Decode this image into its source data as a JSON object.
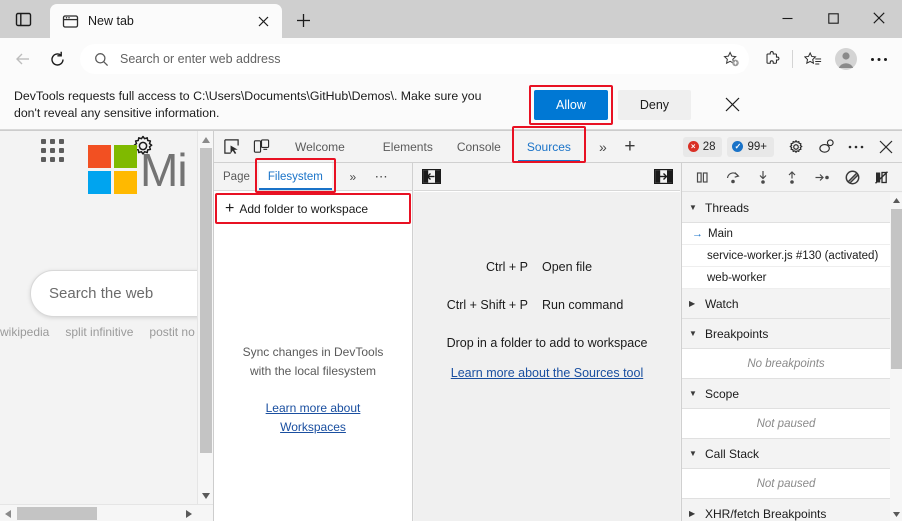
{
  "colors": {
    "accent_blue": "#0078d4",
    "highlight_red": "#e81123",
    "devtools_selected": "#1a73c8",
    "link_blue": "#1a4fa0",
    "ms_logo_red": "#f25022",
    "ms_logo_green": "#7fba00",
    "ms_logo_blue": "#00a4ef",
    "ms_logo_yellow": "#ffb900"
  },
  "browser": {
    "tab": {
      "title": "New tab",
      "favicon_name": "new-tab-favicon",
      "close_label": "×"
    },
    "tab_search_label": "tab-search",
    "new_tab_label": "+",
    "window_controls": {
      "minimize": "—",
      "maximize": "□",
      "close": "✕"
    },
    "toolbar": {
      "back_label": "←",
      "refresh_label": "refresh",
      "address_placeholder": "Search or enter web address",
      "address_value": "",
      "favorite_label": "add-favorite",
      "extensions_label": "extensions",
      "collections_label": "collections",
      "profile_label": "profile",
      "settings_label": "⋯"
    }
  },
  "notification": {
    "message_line1": "DevTools requests full access to C:\\Users\\Documents\\GitHub\\Demos\\. Make sure you",
    "message_line2": "don't reveal any sensitive information.",
    "allow_label": "Allow",
    "deny_label": "Deny",
    "close_label": "✕"
  },
  "page": {
    "waffle_label": "app-launcher",
    "gear_label": "page-settings",
    "brand_text": "Mi",
    "search_placeholder": "Search the web",
    "trending": [
      "wikipedia",
      "split infinitive",
      "postit no"
    ]
  },
  "devtools": {
    "inspect_label": "inspect-element",
    "device_label": "device-emulation",
    "tabs": [
      {
        "label": "Welcome",
        "selected": false
      },
      {
        "label": "Elements",
        "selected": false
      },
      {
        "label": "Console",
        "selected": false
      },
      {
        "label": "Sources",
        "selected": true
      }
    ],
    "more_tabs_label": "»",
    "add_tab_label": "+",
    "errors_count": "28",
    "errors_icon": "error-circle-icon",
    "messages_count": "99+",
    "messages_icon": "info-circle-icon",
    "settings_label": "devtools-settings",
    "customize_label": "devtools-customize",
    "more_label": "⋯",
    "close_label": "✕",
    "navigator": {
      "tabs": [
        {
          "label": "Page",
          "selected": false
        },
        {
          "label": "Filesystem",
          "selected": true
        }
      ],
      "more_label": "»",
      "dots_label": "⋯",
      "add_folder_label": "Add folder to workspace",
      "add_folder_plus": "+",
      "empty_line1": "Sync changes in DevTools",
      "empty_line2": "with the local filesystem",
      "link_line1": "Learn more about",
      "link_line2": "Workspaces"
    },
    "editor": {
      "show_navigator_label": "show-navigator",
      "show_debugger_label": "show-debugger",
      "shortcuts": [
        {
          "key": "Ctrl + P",
          "desc": "Open file"
        },
        {
          "key": "Ctrl + Shift + P",
          "desc": "Run command"
        }
      ],
      "drop_hint": "Drop in a folder to add to workspace",
      "link": "Learn more about the Sources tool"
    },
    "debugger": {
      "controls": [
        "pause-script-button",
        "step-over-button",
        "step-into-button",
        "step-out-button",
        "step-button",
        "deactivate-breakpoints-button",
        "pause-on-exceptions-button"
      ],
      "sections": [
        {
          "title": "Threads",
          "expanded": true,
          "items": [
            {
              "label": "Main",
              "current": true
            },
            {
              "label": "service-worker.js #130 (activated)",
              "current": false
            },
            {
              "label": "web-worker",
              "current": false
            }
          ]
        },
        {
          "title": "Watch",
          "expanded": false,
          "items": []
        },
        {
          "title": "Breakpoints",
          "expanded": true,
          "empty_text": "No breakpoints"
        },
        {
          "title": "Scope",
          "expanded": true,
          "empty_text": "Not paused"
        },
        {
          "title": "Call Stack",
          "expanded": true,
          "empty_text": "Not paused"
        },
        {
          "title": "XHR/fetch Breakpoints",
          "expanded": false,
          "items": []
        }
      ]
    }
  }
}
